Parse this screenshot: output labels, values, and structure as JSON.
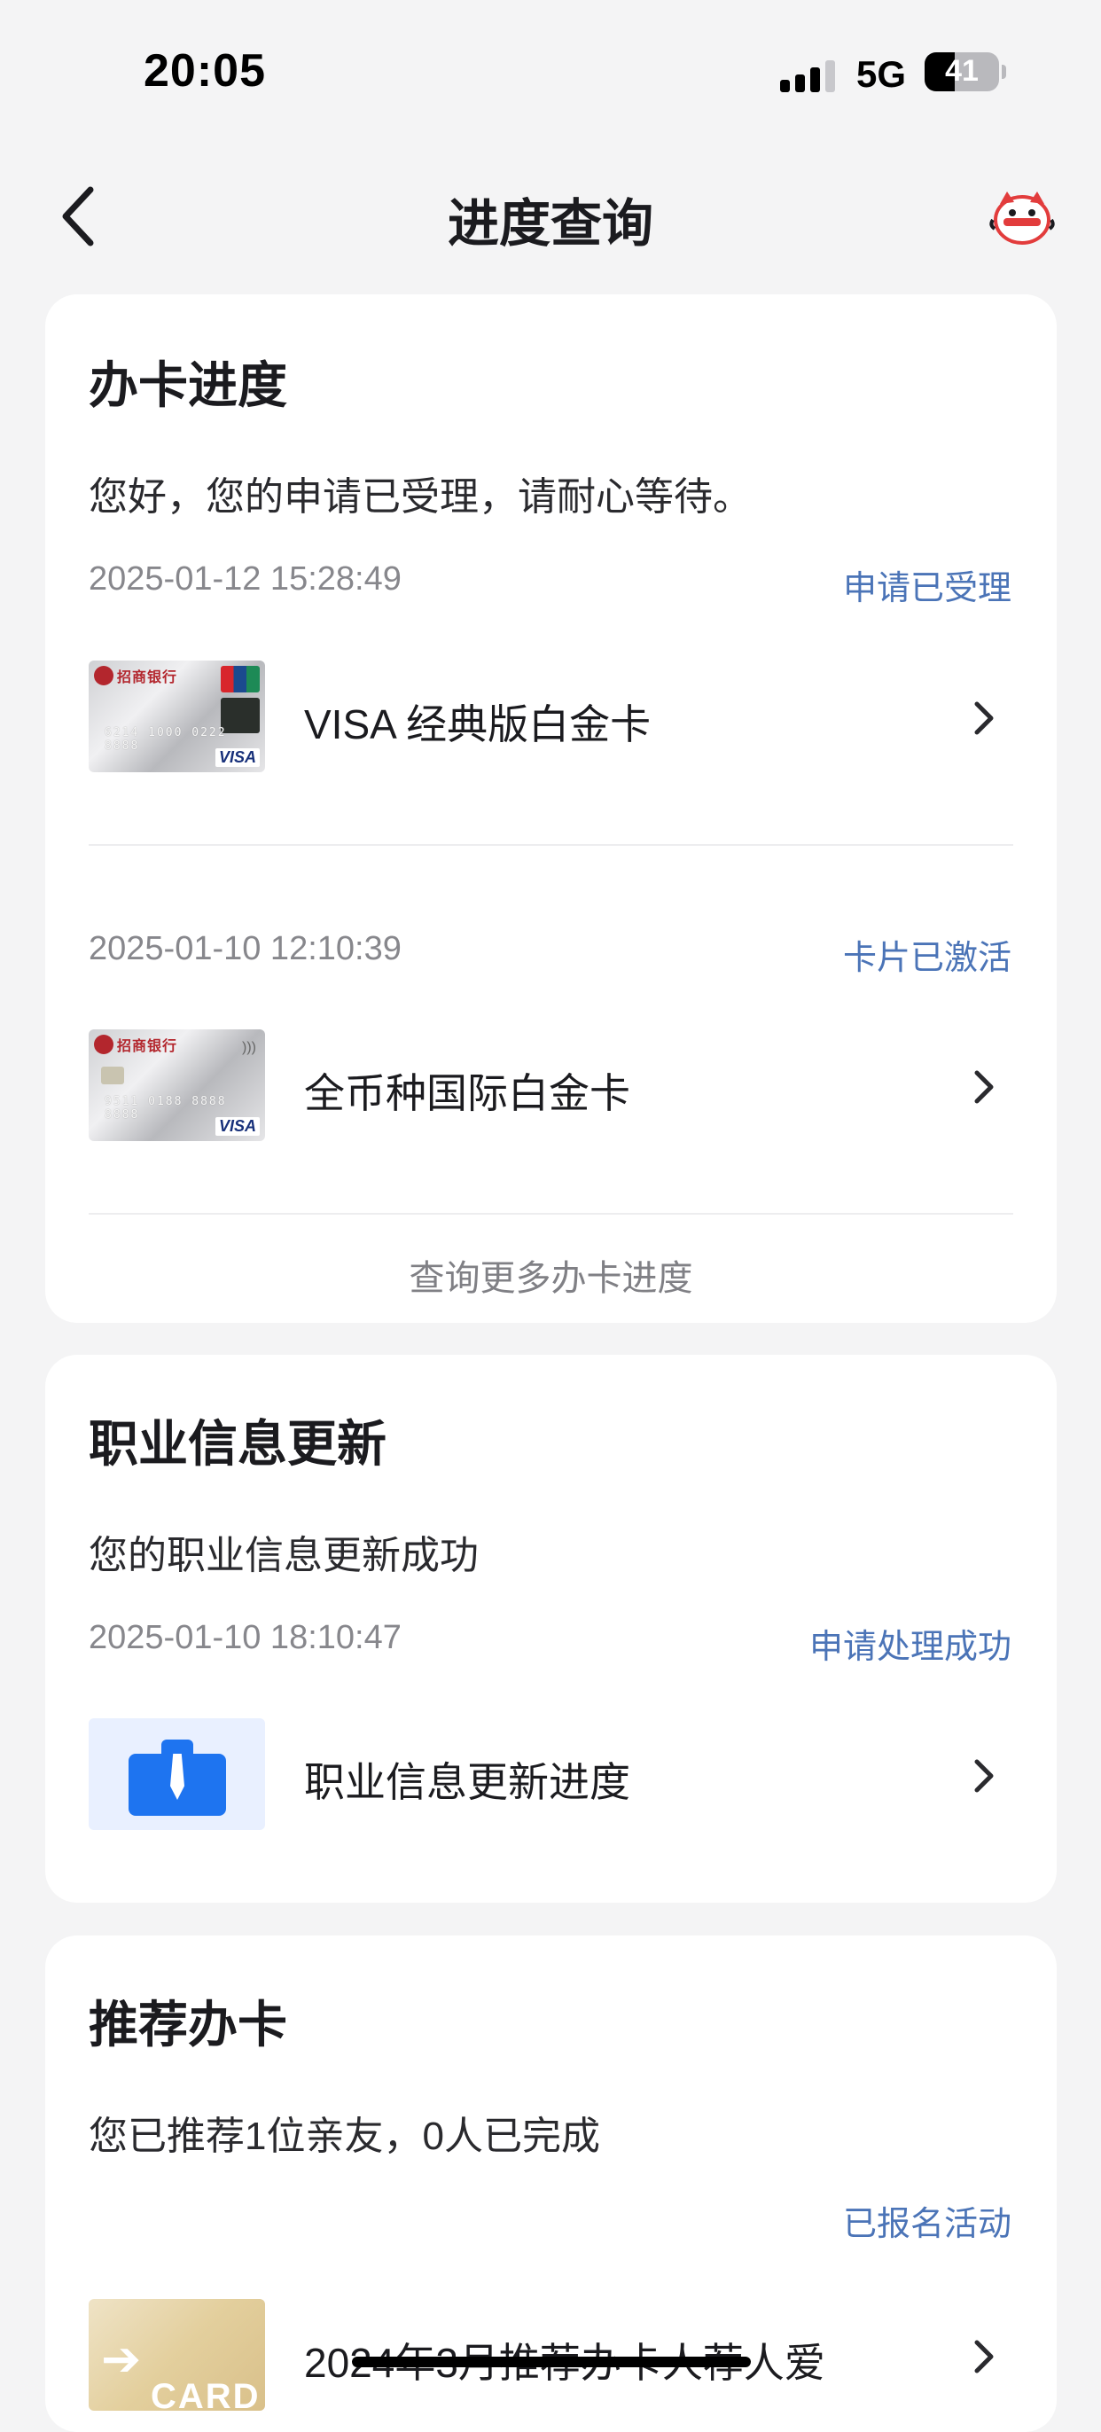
{
  "status_bar": {
    "time": "20:05",
    "network": "5G",
    "battery": "41",
    "battery_level": 0.41
  },
  "nav": {
    "title": "进度查询"
  },
  "card_progress": {
    "title": "办卡进度",
    "desc": "您好，您的申请已受理，请耐心等待。",
    "items": [
      {
        "time": "2025-01-12 15:28:49",
        "status": "申请已受理",
        "label": "VISA 经典版白金卡"
      },
      {
        "time": "2025-01-10 12:10:39",
        "status": "卡片已激活",
        "label": "全币种国际白金卡"
      }
    ],
    "more": "查询更多办卡进度"
  },
  "career_update": {
    "title": "职业信息更新",
    "desc": "您的职业信息更新成功",
    "time": "2025-01-10 18:10:47",
    "status": "申请处理成功",
    "label": "职业信息更新进度"
  },
  "recommend": {
    "title": "推荐办卡",
    "desc": "您已推荐1位亲友，0人已完成",
    "status": "已报名活动",
    "label": "2024年3月推荐办卡人荐人爱",
    "thumb_text": "CARD"
  },
  "card_images": {
    "bank_name": "招商银行",
    "visa": "VISA",
    "digits_1": "6214 1000 0222 8888",
    "digits_2": "9511 0188 8888 8888"
  },
  "colors": {
    "background": "#f4f4f5",
    "card": "#ffffff",
    "status_blue": "#4b74b7",
    "secondary_text": "#87878c"
  },
  "icons": {
    "back": "chevron-left-icon",
    "mascot": "mascot-icon",
    "chevron": "chevron-right-icon",
    "career": "briefcase-icon"
  }
}
